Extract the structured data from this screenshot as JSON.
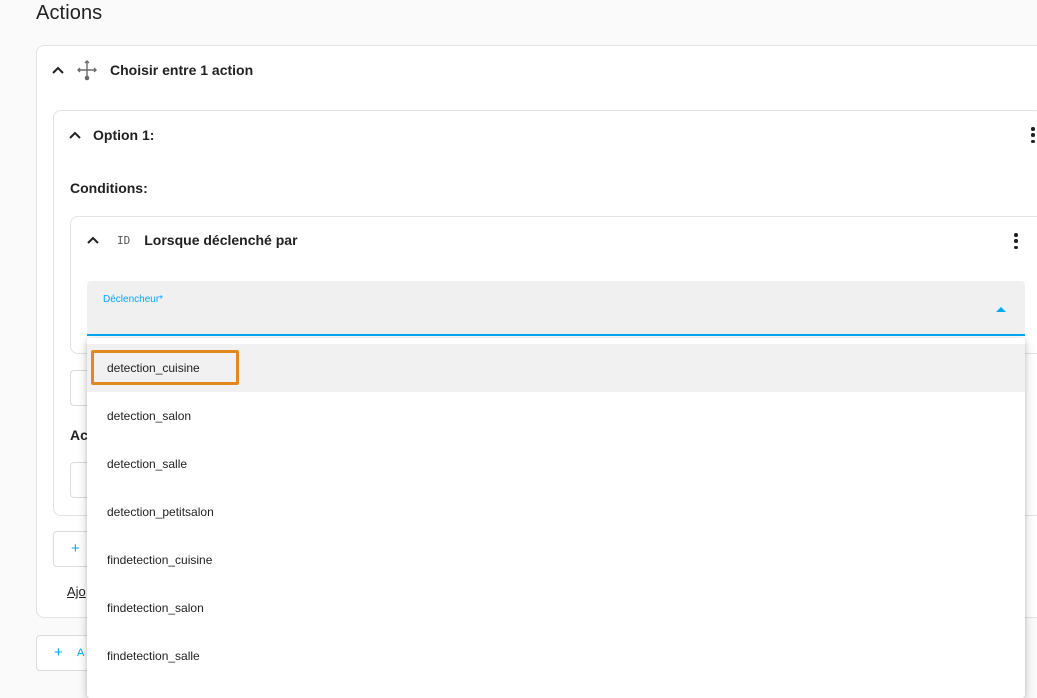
{
  "page": {
    "title": "Actions"
  },
  "choose_block": {
    "label": "Choisir entre 1 action"
  },
  "option": {
    "label": "Option 1:"
  },
  "conditions": {
    "heading": "Conditions:"
  },
  "condition_card": {
    "label": "Lorsque déclenché par",
    "icon_text": "ID"
  },
  "trigger_field": {
    "label": "Déclencheur*"
  },
  "dropdown": {
    "items": [
      "detection_cuisine",
      "detection_salon",
      "detection_salle",
      "detection_petitsalon",
      "findetection_cuisine",
      "findetection_salon",
      "findetection_salle"
    ]
  },
  "partials": {
    "actions_heading": "Ac",
    "add_plus": "+",
    "add_link": "Ajo",
    "add_action_plus": "+",
    "add_action_text": "A"
  },
  "colors": {
    "accent": "#03a9f4",
    "highlight": "#e08a1e"
  }
}
